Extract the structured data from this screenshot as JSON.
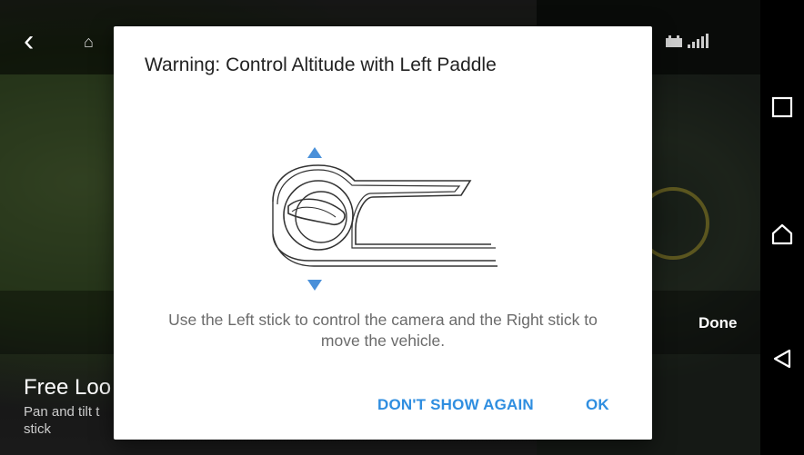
{
  "background": {
    "mode_title": "Free Loo",
    "mode_description": "Pan and tilt t stick",
    "done_label": "Done"
  },
  "dialog": {
    "title": "Warning: Control Altitude with Left Paddle",
    "body": "Use the Left stick to control the camera and the Right stick to move the vehicle.",
    "dont_show_again_label": "DON'T SHOW AGAIN",
    "ok_label": "OK",
    "accent_color": "#2f8ee0"
  },
  "icons": {
    "back": "chevron-left-icon",
    "home": "home-icon",
    "controller": "controller-icon",
    "signal": "signal-icon",
    "recent_apps": "square-icon",
    "home_nav": "home-outline-icon",
    "back_nav": "triangle-back-icon"
  }
}
